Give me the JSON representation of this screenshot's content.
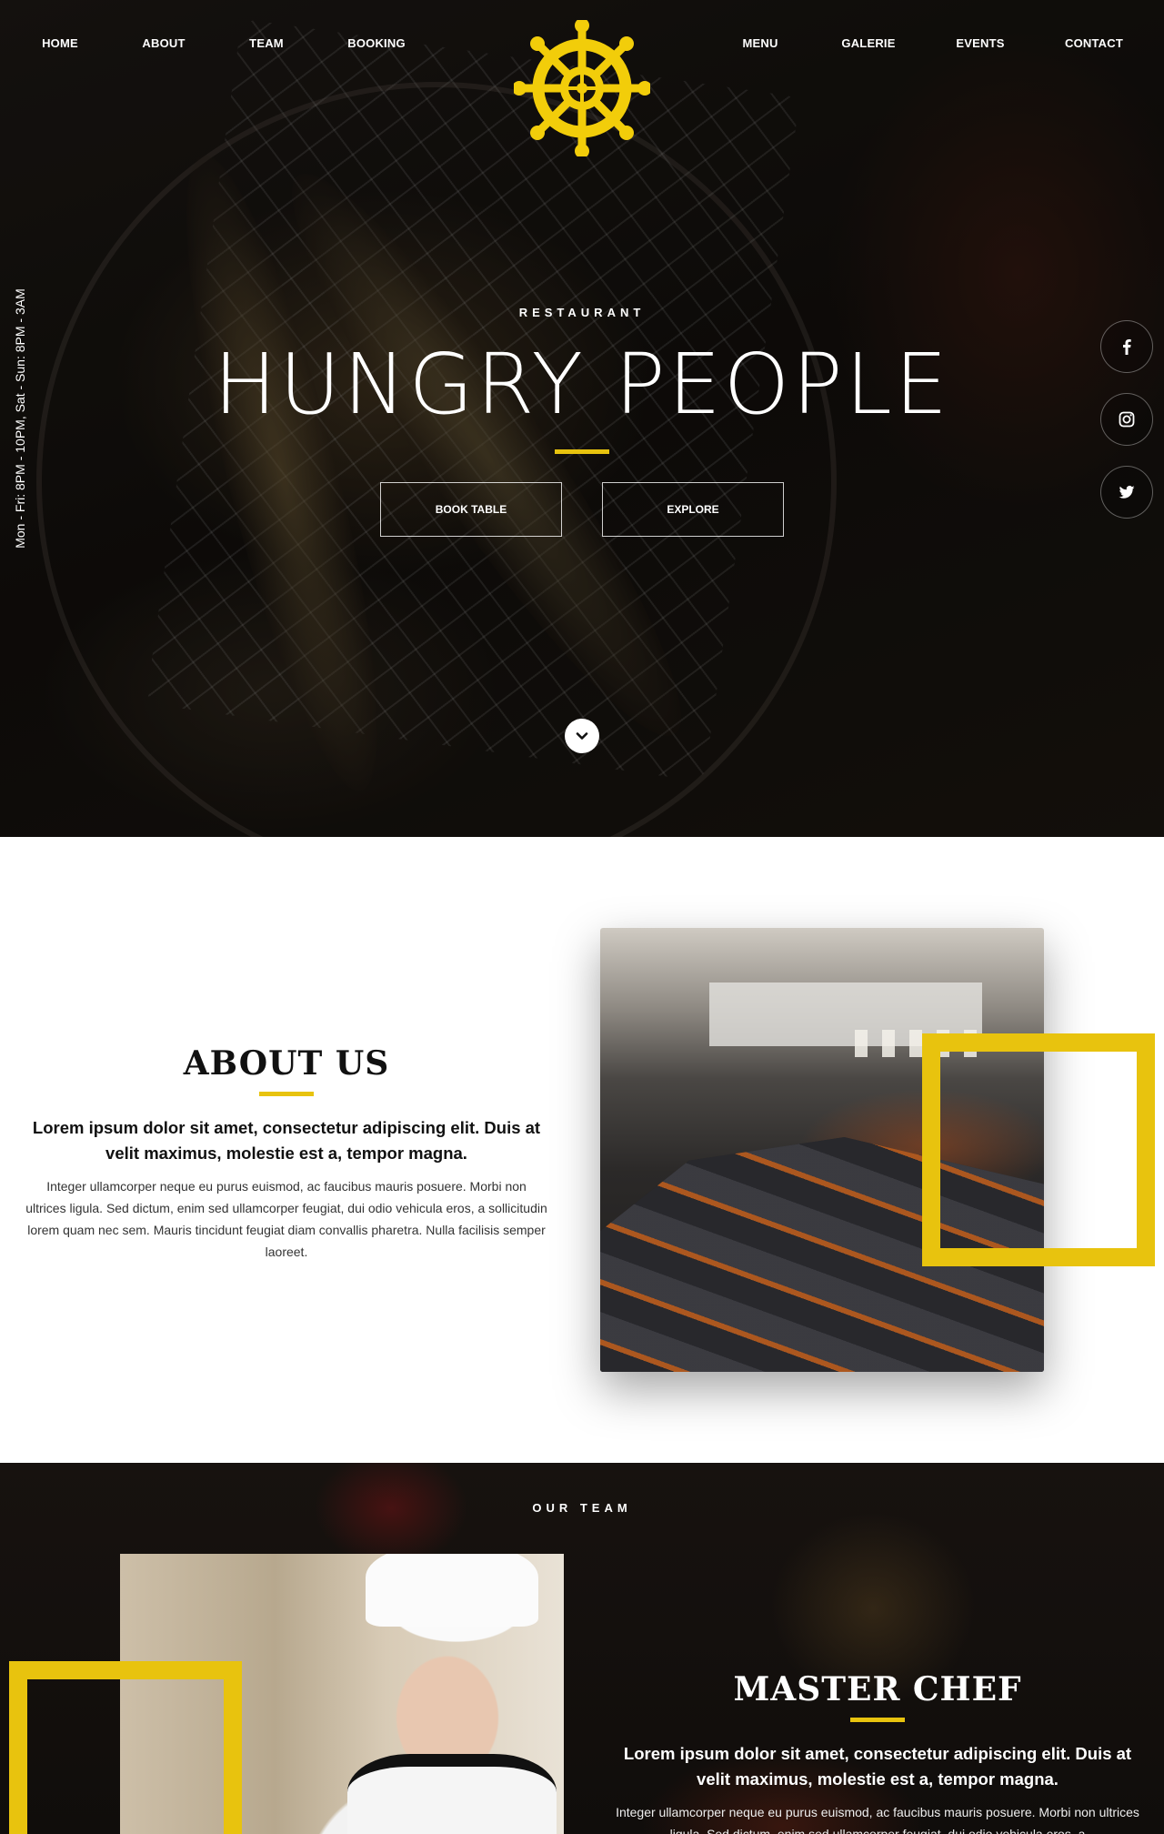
{
  "colors": {
    "accent": "#e8c30e",
    "hero_bg": "#15110e",
    "team_bg": "#130f0d"
  },
  "nav": {
    "left": [
      "HOME",
      "ABOUT",
      "TEAM",
      "BOOKING"
    ],
    "right": [
      "MENU",
      "GALERIE",
      "EVENTS",
      "CONTACT"
    ]
  },
  "logo": {
    "icon": "ship-wheel-icon"
  },
  "hero": {
    "hours": "Mon - Fri: 8PM - 10PM, Sat - Sun: 8PM - 3AM",
    "eyebrow": "RESTAURANT",
    "title": "HUNGRY PEOPLE",
    "buttons": {
      "book": "BOOK TABLE",
      "explore": "EXPLORE"
    },
    "social": [
      "facebook-icon",
      "instagram-icon",
      "twitter-icon"
    ],
    "scroll_icon": "chevron-down-icon"
  },
  "about": {
    "title": "ABOUT US",
    "lead": "Lorem ipsum dolor sit amet, consectetur adipiscing elit. Duis at velit maximus, molestie est a, tempor magna.",
    "body": "Integer ullamcorper neque eu purus euismod, ac faucibus mauris posuere. Morbi non ultrices ligula. Sed dictum, enim sed ullamcorper feugiat, dui odio vehicula eros, a sollicitudin lorem quam nec sem. Mauris tincidunt feugiat diam convallis pharetra. Nulla facilisis semper laoreet."
  },
  "team": {
    "eyebrow": "OUR TEAM",
    "title": "MASTER CHEF",
    "lead": "Lorem ipsum dolor sit amet, consectetur adipiscing elit. Duis at velit maximus, molestie est a, tempor magna.",
    "body": "Integer ullamcorper neque eu purus euismod, ac faucibus mauris posuere. Morbi non ultrices ligula. Sed dictum, enim sed ullamcorper feugiat, dui odio vehicula eros, a"
  }
}
